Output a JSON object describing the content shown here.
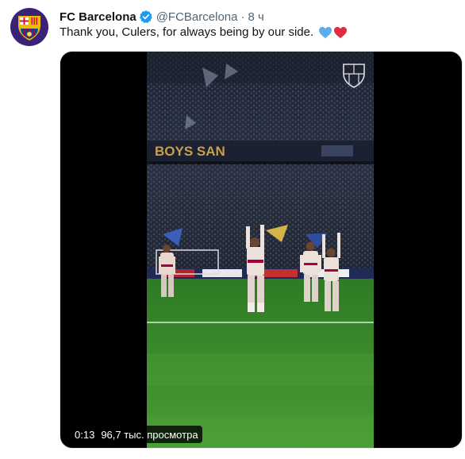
{
  "tweet": {
    "author_name": "FC Barcelona",
    "author_handle": "@FCBarcelona",
    "separator": "·",
    "time_ago": "8 ч",
    "text": "Thank you, Culers, for always being by our side.",
    "emoji": [
      "blue-heart-icon",
      "red-heart-icon"
    ],
    "video": {
      "duration": "0:13",
      "views": "96,7 тыс. просмотра",
      "banner_text": "BOYS SAN"
    }
  },
  "colors": {
    "brand_blue": "#1d9bf0",
    "muted_text": "#536471",
    "pitch_green": "#3f8a2e",
    "barca_blue": "#004d98",
    "barca_red": "#a50044",
    "barca_gold": "#edbb00"
  }
}
